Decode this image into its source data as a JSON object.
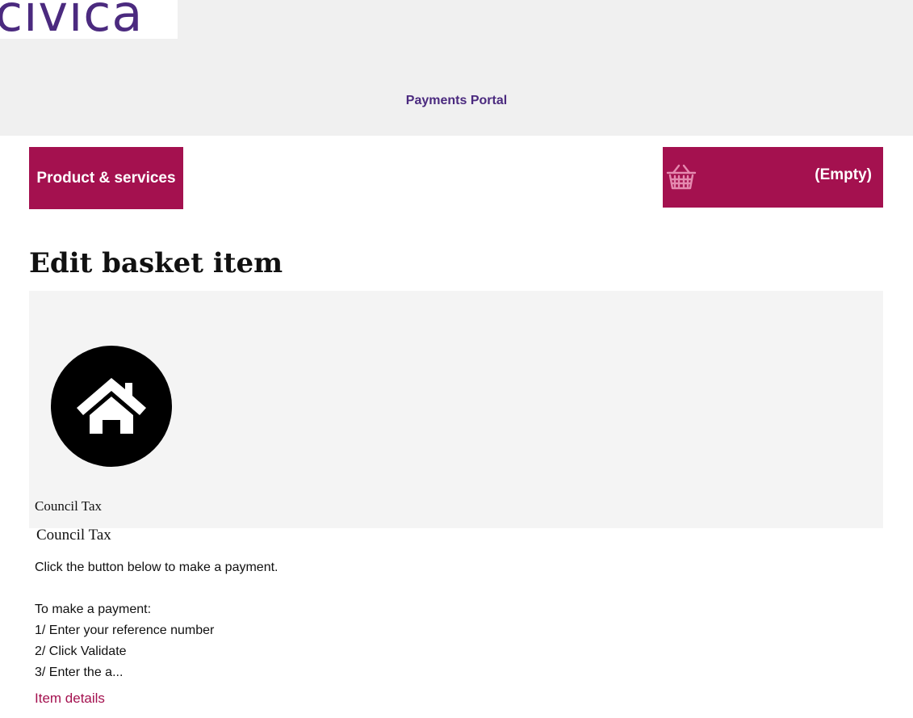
{
  "brand": {
    "logo_text": "civica",
    "color": "#4b2a7f"
  },
  "header": {
    "portal_title": "Payments Portal"
  },
  "nav": {
    "products_label": "Product & services",
    "basket_label": "(Empty)",
    "basket_icon": "basket-icon",
    "accent_color": "#a4114f"
  },
  "main": {
    "heading": "Edit basket item",
    "item": {
      "icon": "house-icon",
      "caption": "Council Tax",
      "name": "Council Tax",
      "description": {
        "intro": "Click the button below to make a payment.",
        "steps_title": "To make a payment:",
        "step1": "1/ Enter your reference number",
        "step2": "2/ Click Validate",
        "step3": "3/ Enter the a..."
      },
      "details_link": "Item details"
    }
  }
}
